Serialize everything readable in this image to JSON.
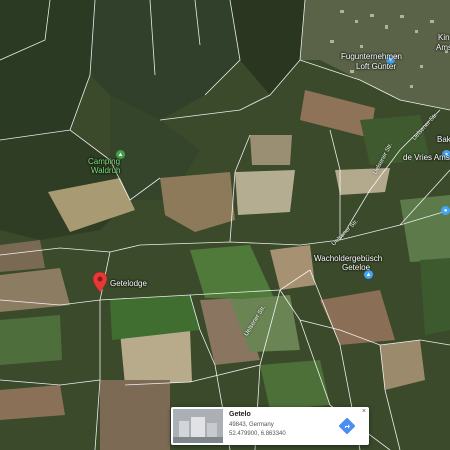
{
  "map": {
    "labels": {
      "fugunternehmen": "Fugunternehmen",
      "loft_gunter": "Loft Günter",
      "kin": "Kin",
      "ams": "Ams",
      "camping": "Camping",
      "waldruh": "Waldruh",
      "bak": "Bak",
      "de_vries": "de Vries Ams",
      "geteloge": "Getelodge",
      "wacholder": "Wacholdergebüsch",
      "geteloe": "Geteloe"
    },
    "roads": {
      "r1": "Uelsener Str.",
      "r2": "Uelsener Str.",
      "r3": "Uelsener Str.",
      "r4": "Uelsener Str."
    }
  },
  "info_card": {
    "title": "Getelo",
    "address": "49843, Germany",
    "coordinates": "52.479900, 6.863340",
    "close": "×"
  },
  "colors": {
    "pin": "#e53935",
    "directions": "#4a8ef5",
    "poi_blue": "#42a5f5",
    "poi_green": "#43a047"
  }
}
